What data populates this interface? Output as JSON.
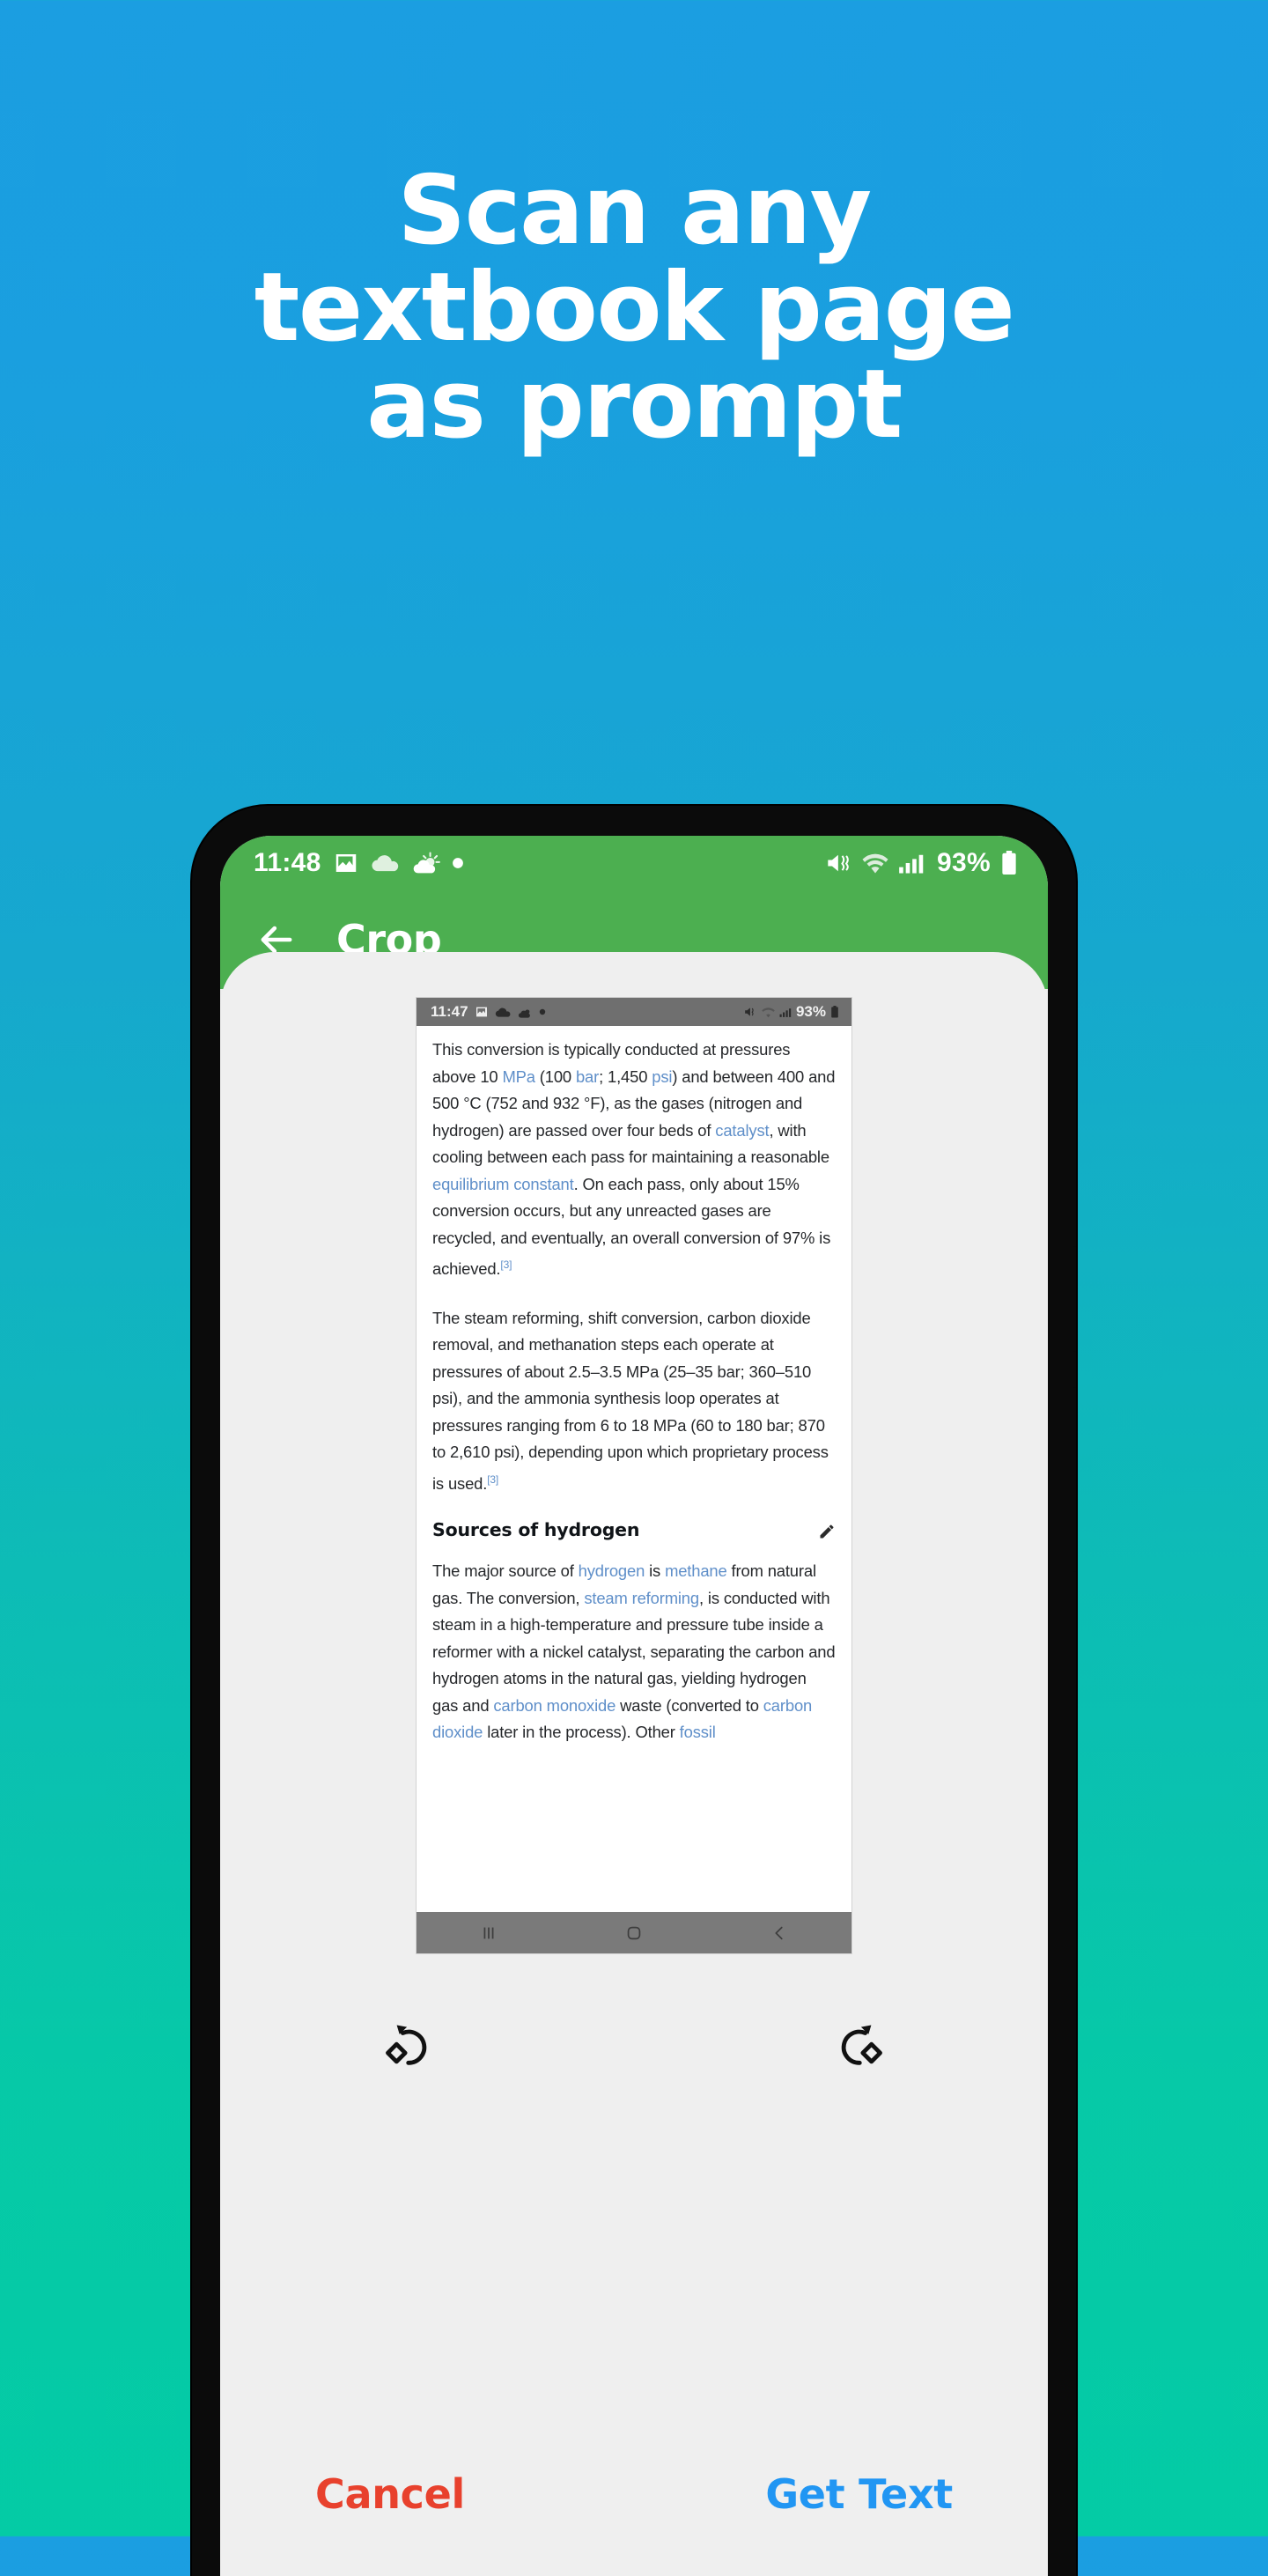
{
  "promo": {
    "lines": [
      "Scan any",
      "textbook page",
      "as prompt"
    ],
    "text_color": "#ffffff",
    "bg_gradient_top": "#1b9ee1",
    "bg_gradient_bottom": "#04cba5"
  },
  "phone": {
    "status_bar": {
      "time": "11:48",
      "battery_percent": "93%",
      "left_icons": [
        "image-icon",
        "cloud-icon",
        "partly-cloudy-icon",
        "dot-icon"
      ],
      "right_icons": [
        "mute-vibrate-icon",
        "wifi-icon",
        "signal-icon",
        "battery-icon"
      ],
      "bg_color": "#4caf50"
    },
    "app_bar": {
      "back_label": "back-arrow",
      "title": "Crop",
      "bg_color": "#4caf50"
    },
    "nav_bar": {
      "recents": "|||",
      "home": "home-circle",
      "back": "back-chevron"
    }
  },
  "crop_preview": {
    "inner_status_bar": {
      "time": "11:47",
      "battery_percent": "93%"
    },
    "paragraph_1": {
      "s1": "This conversion is typically conducted at pressures above 10 ",
      "l1": "MPa",
      "s2": " (100 ",
      "l2": "bar",
      "s3": "; 1,450 ",
      "l3": "psi",
      "s4": ") and between 400 and 500 °C (752 and 932 °F), as the gases (nitrogen and hydrogen) are passed over four beds of ",
      "l4": "catalyst",
      "s5": ", with cooling between each pass for maintaining a reasonable ",
      "l5": "equilibrium constant",
      "s6": ". On each pass, only about 15% conversion occurs, but any unreacted gases are recycled, and eventually, an overall conversion of 97% is achieved.",
      "ref": "[3]"
    },
    "paragraph_2": {
      "s1": "The steam reforming, shift conversion, carbon dioxide removal, and methanation steps each operate at pressures of about 2.5–3.5 MPa (25–35 bar; 360–510 psi), and the ammonia synthesis loop operates at pressures ranging from 6 to 18 MPa (60 to 180 bar; 870 to 2,610 psi), depending upon which proprietary process is used.",
      "ref": "[3]"
    },
    "section_heading": "Sources of hydrogen",
    "paragraph_3": {
      "s1": "The major source of ",
      "l1": "hydrogen",
      "s2": " is ",
      "l2": "methane",
      "s3": " from natural gas. The conversion, ",
      "l3": "steam reforming",
      "s4": ", is conducted with steam in a high-temperature and pressure tube inside a reformer with a nickel catalyst, separating the carbon and hydrogen atoms in the natural gas, yielding hydrogen gas and ",
      "l4": "carbon monoxide",
      "s5": " waste (converted to ",
      "l5": "carbon dioxide",
      "s6": " later in the process). Other ",
      "l6": "fossil"
    },
    "link_color": "#5f8fc9"
  },
  "tools": {
    "rotate_left": "rotate-left-icon",
    "rotate_right": "rotate-right-icon"
  },
  "actions": {
    "cancel_label": "Cancel",
    "cancel_color": "#e8412d",
    "get_text_label": "Get Text",
    "get_text_color": "#2196f3"
  }
}
